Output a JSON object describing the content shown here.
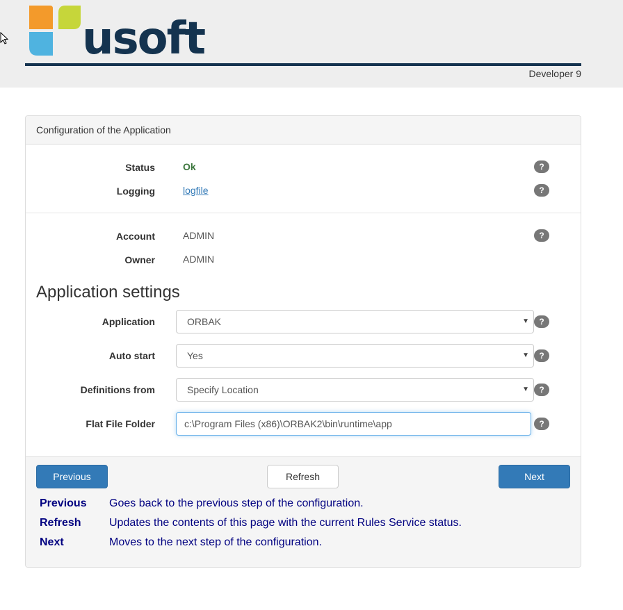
{
  "header": {
    "brand_text": "usoft",
    "version": "Developer 9"
  },
  "panel": {
    "title": "Configuration of the Application"
  },
  "status": {
    "status_label": "Status",
    "status_value": "Ok",
    "logging_label": "Logging",
    "logging_value": "logfile"
  },
  "account": {
    "account_label": "Account",
    "account_value": "ADMIN",
    "owner_label": "Owner",
    "owner_value": "ADMIN"
  },
  "settings": {
    "title": "Application settings",
    "application_label": "Application",
    "application_value": "ORBAK",
    "autostart_label": "Auto start",
    "autostart_value": "Yes",
    "definitions_label": "Definitions from",
    "definitions_value": "Specify Location",
    "flatfile_label": "Flat File Folder",
    "flatfile_value": "c:\\Program Files (x86)\\ORBAK2\\bin\\runtime\\app"
  },
  "help_glyph": "?",
  "buttons": {
    "previous": "Previous",
    "refresh": "Refresh",
    "next": "Next"
  },
  "help_items": [
    {
      "term": "Previous",
      "desc": "Goes back to the previous step of the configuration."
    },
    {
      "term": "Refresh",
      "desc": "Updates the contents of this page with the current Rules Service status."
    },
    {
      "term": "Next",
      "desc": "Moves to the next step of the configuration."
    }
  ],
  "colors": {
    "brand_navy": "#14334f",
    "logo_orange": "#f39a2b",
    "logo_green": "#c6d63a",
    "logo_blue": "#4fb3e0",
    "primary": "#337ab7",
    "ok_green": "#3c763d"
  },
  "icons": {
    "cursor": "mouse-pointer-icon",
    "help": "question-circle-icon",
    "dropdown": "caret-down-icon"
  }
}
